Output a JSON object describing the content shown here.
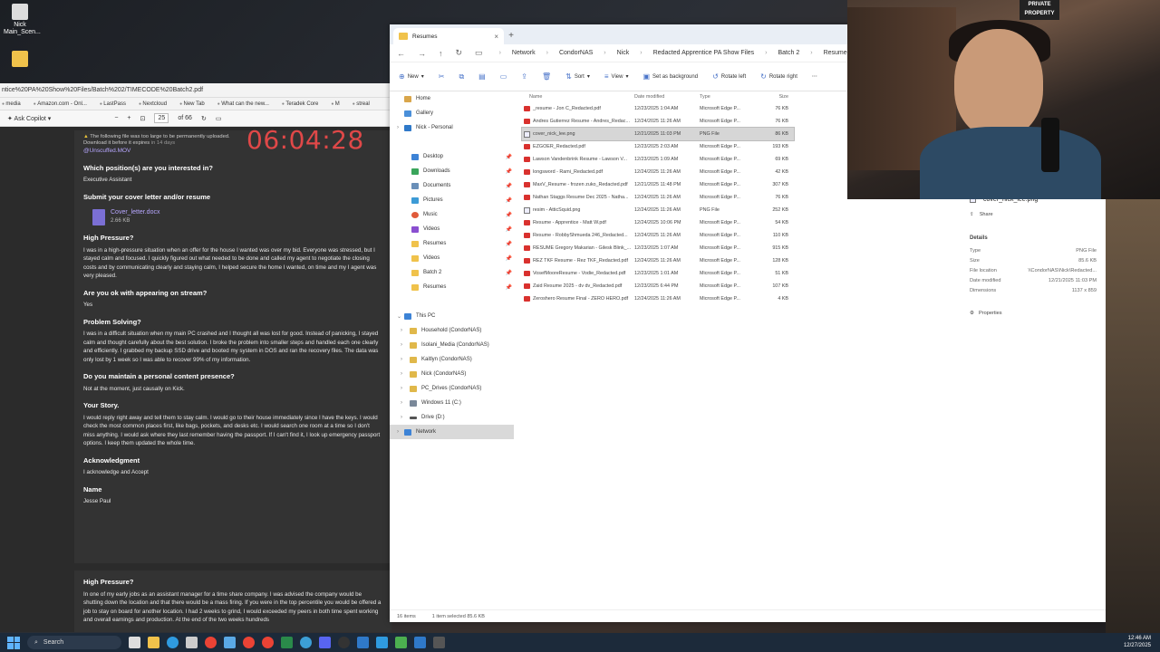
{
  "desktop": {
    "icon_label": "Nick\nMain_Scen..."
  },
  "browser": {
    "url": "ntice%20PA%20Show%20Files/Batch%202/TIMECODE%20Batch2.pdf",
    "bookmarks": [
      "media",
      "Amazon.com - Onl...",
      "LastPass",
      "Nextcloud",
      "New Tab",
      "What can the new...",
      "Teradek Core",
      "M",
      "streal"
    ],
    "toolbar": {
      "copilot": "Ask Copilot",
      "page": "25",
      "page_total": "of 66"
    }
  },
  "pdf": {
    "warning_line1": "The following file was too large to be permanently uploaded.",
    "warning_line2": "Download it before it expires",
    "warning_days": "in 14 days",
    "mov_file": "Unscuffed.MOV",
    "timer": "06:04:28",
    "sections": [
      {
        "q": "Which position(s) are you interested in?",
        "a": "Executive Assistant"
      },
      {
        "q": "Submit your cover letter and/or resume",
        "a": ""
      },
      {
        "q": "High Pressure?",
        "a": "I was in a high-pressure situation when an offer for the house I wanted was over my bid. Everyone was stressed, but I stayed calm and focused. I quickly figured out what needed to be done and called my agent to negotiate the closing costs and by communicating clearly and staying calm, I helped secure the home I wanted, on time and my I agent was very  pleased."
      },
      {
        "q": "Are you ok with appearing on stream?",
        "a": "Yes"
      },
      {
        "q": "Problem Solving?",
        "a": "I was in a difficult situation when my main PC crashed and I thought all was lost for good. Instead of panicking, I stayed calm and thought carefully about the best solution. I broke the problem into smaller steps and handled each one clearly and efficiently. I grabbed my backup SSD drive and booted my system in DOS and ran the recovery files. The data was only lost by 1 week so I was able to recover 99% of my information."
      },
      {
        "q": "Do you maintain a personal content presence?",
        "a": "Not at the moment, just causally on Kick."
      },
      {
        "q": "Your Story.",
        "a": "I would reply right away and tell them to stay calm.  I would go to their house immediately since I have the keys.  I would check the most common places first, like bags, pockets, and desks etc.  I would search one room at a time so I don't miss anything.  I would ask where they last remember having the passport.  If I can't find it, I look up emergency passport options.  I keep them updated the whole time."
      },
      {
        "q": "Acknowledgment",
        "a": "I acknowledge and Accept"
      },
      {
        "q": "Name",
        "a": "Jesse Paul"
      }
    ],
    "attachment": {
      "name": "Cover_letter.docx",
      "size": "2.66 KB"
    },
    "page2": {
      "q": "High Pressure?",
      "a": "In one of my early jobs as an assistant manager for a time share company. I was advised the company would be shutting down the location and that there would be a mass firing. If you were in the top percentile you would be offered a job to stay on board for another location. I had 2 weeks to grind, I would exceeded my peers in both time spent working and overall earnings and production. At the end of the two weeks hundreds"
    }
  },
  "explorer": {
    "tab_title": "Resumes",
    "breadcrumbs": [
      "Network",
      "CondorNAS",
      "Nick",
      "Redacted Apprentice PA Show Files",
      "Batch 2",
      "Resumes"
    ],
    "commands": [
      "New",
      "Sort",
      "View",
      "Set as background",
      "Rotate left",
      "Rotate right"
    ],
    "nav": {
      "top": [
        "Home",
        "Gallery",
        "Nick - Personal"
      ],
      "quick": [
        "Desktop",
        "Downloads",
        "Documents",
        "Pictures",
        "Music",
        "Videos",
        "Resumes",
        "Videos",
        "Batch 2",
        "Resumes"
      ],
      "this_pc": "This PC",
      "drives": [
        "Household (CondorNAS)",
        "Isolani_Media (CondorNAS)",
        "Kaitlyn (CondorNAS)",
        "Nick (CondorNAS)",
        "PC_Drives (CondorNAS)",
        "Windows 11 (C:)",
        "Drive (D:)"
      ],
      "network": "Network"
    },
    "columns": [
      "Name",
      "Date modified",
      "Type",
      "Size"
    ],
    "files": [
      {
        "name": "_resume - Jon C_Redacted.pdf",
        "date": "12/23/2025 1:04 AM",
        "type": "Microsoft Edge P...",
        "size": "76 KB",
        "kind": "pdf"
      },
      {
        "name": "Andres Gutierrez Resume - Andres_Redac...",
        "date": "12/24/2025 11:26 AM",
        "type": "Microsoft Edge P...",
        "size": "76 KB",
        "kind": "pdf"
      },
      {
        "name": "cover_nick_lee.png",
        "date": "12/21/2025 11:03 PM",
        "type": "PNG File",
        "size": "86 KB",
        "kind": "png",
        "selected": true
      },
      {
        "name": "EZGOER_Redacted.pdf",
        "date": "12/23/2025 2:03 AM",
        "type": "Microsoft Edge P...",
        "size": "193 KB",
        "kind": "pdf"
      },
      {
        "name": "Lawson Vandenbrink Resume - Lawson V...",
        "date": "12/23/2025 1:09 AM",
        "type": "Microsoft Edge P...",
        "size": "69 KB",
        "kind": "pdf"
      },
      {
        "name": "longsword - Rami_Redacted.pdf",
        "date": "12/24/2025 11:26 AM",
        "type": "Microsoft Edge P...",
        "size": "42 KB",
        "kind": "pdf"
      },
      {
        "name": "MaxV_Resume - frozen zuko_Redacted.pdf",
        "date": "12/21/2025 11:48 PM",
        "type": "Microsoft Edge P...",
        "size": "307 KB",
        "kind": "pdf"
      },
      {
        "name": "Nathan Staggs Resume Dec 2025 - Natha...",
        "date": "12/24/2025 11:26 AM",
        "type": "Microsoft Edge P...",
        "size": "76 KB",
        "kind": "pdf"
      },
      {
        "name": "resim - AtticSquid.png",
        "date": "12/24/2025 11:26 AM",
        "type": "PNG File",
        "size": "252 KB",
        "kind": "png"
      },
      {
        "name": "Resume - Apprentice - Matt W.pdf",
        "date": "12/24/2025 10:06 PM",
        "type": "Microsoft Edge P...",
        "size": "54 KB",
        "kind": "pdf"
      },
      {
        "name": "Resume - RobbyShmueda 246_Redacted...",
        "date": "12/24/2025 11:26 AM",
        "type": "Microsoft Edge P...",
        "size": "110 KB",
        "kind": "pdf"
      },
      {
        "name": "RESUME Gregory Makarian - Gilesk Blink_...",
        "date": "12/23/2025 1:07 AM",
        "type": "Microsoft Edge P...",
        "size": "915 KB",
        "kind": "pdf"
      },
      {
        "name": "REZ TKF Resume - Rez TKF_Redacted.pdf",
        "date": "12/24/2025 11:26 AM",
        "type": "Microsoft Edge P...",
        "size": "128 KB",
        "kind": "pdf"
      },
      {
        "name": "VosefMooreResume - Vodie_Redacted.pdf",
        "date": "12/23/2025 1:01 AM",
        "type": "Microsoft Edge P...",
        "size": "51 KB",
        "kind": "pdf"
      },
      {
        "name": "Zaid Resume 2025 - dv dv_Redacted.pdf",
        "date": "12/23/2025 6:44 PM",
        "type": "Microsoft Edge P...",
        "size": "107 KB",
        "kind": "pdf"
      },
      {
        "name": "Zeroshero Resume Final - ZERO HERO.pdf",
        "date": "12/24/2025 11:26 AM",
        "type": "Microsoft Edge P...",
        "size": "4 KB",
        "kind": "pdf"
      }
    ],
    "details": {
      "file_name": "cover_nick_lee.png",
      "share": "Share",
      "section": "Details",
      "rows": [
        {
          "k": "Type",
          "v": "PNG File"
        },
        {
          "k": "Size",
          "v": "85.6 KB"
        },
        {
          "k": "File location",
          "v": "\\\\CondorNAS\\Nick\\Redacted..."
        },
        {
          "k": "Date modified",
          "v": "12/21/2025 11:03 PM"
        },
        {
          "k": "Dimensions",
          "v": "1137 x 859"
        }
      ],
      "properties": "Properties"
    },
    "status": {
      "items": "16 items",
      "selected": "1 item selected  85.6 KB"
    }
  },
  "webcam": {
    "sign": "PRIVATE PROPERTY"
  },
  "taskbar": {
    "search": "Search",
    "time": "12:46 AM",
    "date": "12/27/2025"
  }
}
